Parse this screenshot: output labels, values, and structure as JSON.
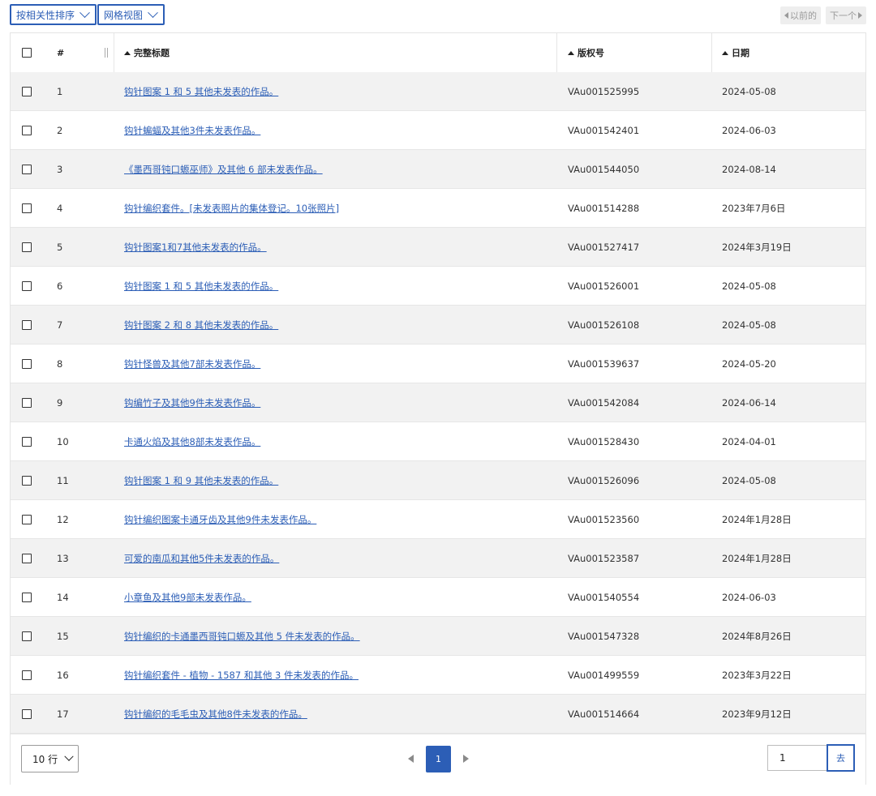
{
  "toolbar": {
    "sort_label": "按相关性排序",
    "view_label": "网格视图",
    "prev_label": "以前的",
    "next_label": "下一个"
  },
  "table": {
    "columns": {
      "num": "#",
      "title": "完整标题",
      "reg": "版权号",
      "date": "日期"
    },
    "rows": [
      {
        "num": "1",
        "title": "钩针图案 1 和 5 其他未发表的作品。",
        "reg": "VAu001525995",
        "date": "2024-05-08"
      },
      {
        "num": "2",
        "title": "钩针蝙蝠及其他3件未发表作品。",
        "reg": "VAu001542401",
        "date": "2024-06-03"
      },
      {
        "num": "3",
        "title": "《墨西哥钝口螈巫师》及其他 6 部未发表作品。",
        "reg": "VAu001544050",
        "date": "2024-08-14"
      },
      {
        "num": "4",
        "title": "钩针编织套件。[未发表照片的集体登记。10张照片]",
        "reg": "VAu001514288",
        "date": "2023年7月6日"
      },
      {
        "num": "5",
        "title": "钩针图案1和7其他未发表的作品。",
        "reg": "VAu001527417",
        "date": "2024年3月19日"
      },
      {
        "num": "6",
        "title": "钩针图案 1 和 5 其他未发表的作品。",
        "reg": "VAu001526001",
        "date": "2024-05-08"
      },
      {
        "num": "7",
        "title": "钩针图案 2 和 8 其他未发表的作品。",
        "reg": "VAu001526108",
        "date": "2024-05-08"
      },
      {
        "num": "8",
        "title": "钩针怪兽及其他7部未发表作品。",
        "reg": "VAu001539637",
        "date": "2024-05-20"
      },
      {
        "num": "9",
        "title": "钩编竹子及其他9件未发表作品。",
        "reg": "VAu001542084",
        "date": "2024-06-14"
      },
      {
        "num": "10",
        "title": "卡通火焰及其他8部未发表作品。",
        "reg": "VAu001528430",
        "date": "2024-04-01"
      },
      {
        "num": "11",
        "title": "钩针图案 1 和 9 其他未发表的作品。",
        "reg": "VAu001526096",
        "date": "2024-05-08"
      },
      {
        "num": "12",
        "title": "钩针编织图案卡通牙齿及其他9件未发表作品。",
        "reg": "VAu001523560",
        "date": "2024年1月28日"
      },
      {
        "num": "13",
        "title": "可爱的南瓜和其他5件未发表的作品。",
        "reg": "VAu001523587",
        "date": "2024年1月28日"
      },
      {
        "num": "14",
        "title": "小章鱼及其他9部未发表作品。",
        "reg": "VAu001540554",
        "date": "2024-06-03"
      },
      {
        "num": "15",
        "title": "钩针编织的卡通墨西哥钝口螈及其他 5 件未发表的作品。",
        "reg": "VAu001547328",
        "date": "2024年8月26日"
      },
      {
        "num": "16",
        "title": "钩针编织套件 - 植物 - 1587 和其他 3 件未发表的作品。",
        "reg": "VAu001499559",
        "date": "2023年3月22日"
      },
      {
        "num": "17",
        "title": "钩针编织的毛毛虫及其他8件未发表的作品。",
        "reg": "VAu001514664",
        "date": "2023年9月12日"
      }
    ]
  },
  "footer": {
    "rows_per_page": "10 行",
    "current_page": "1",
    "goto_value": "1",
    "goto_label": "去"
  }
}
